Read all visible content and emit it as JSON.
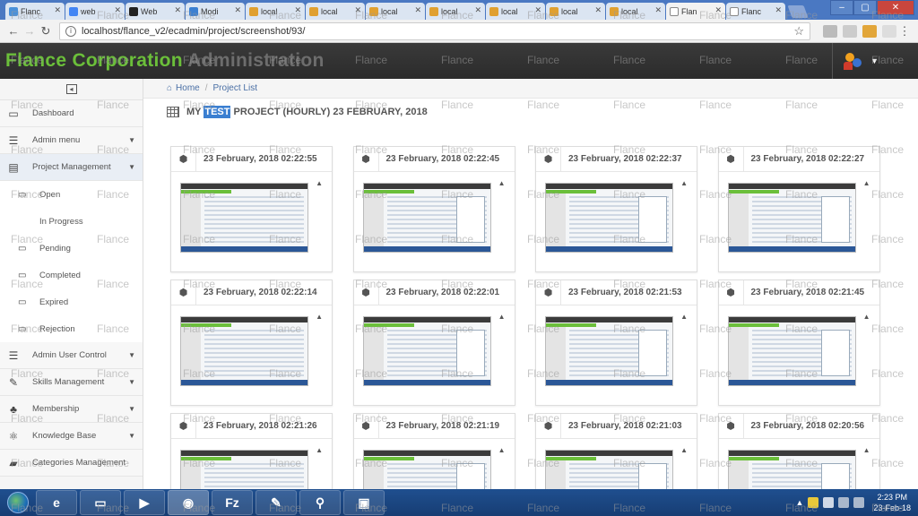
{
  "browser": {
    "tabs": [
      {
        "label": "Flanc",
        "active": false,
        "favicon_color": "#4a90d9"
      },
      {
        "label": "web",
        "active": false,
        "favicon_color": "#4285f4"
      },
      {
        "label": "Web",
        "active": false,
        "favicon_color": "#222222"
      },
      {
        "label": "Modi",
        "active": false,
        "favicon_color": "#3b7fd1"
      },
      {
        "label": "local",
        "active": false,
        "favicon_color": "#e0a030"
      },
      {
        "label": "local",
        "active": false,
        "favicon_color": "#e0a030"
      },
      {
        "label": "local",
        "active": false,
        "favicon_color": "#e0a030"
      },
      {
        "label": "local",
        "active": false,
        "favicon_color": "#e0a030"
      },
      {
        "label": "local",
        "active": false,
        "favicon_color": "#e0a030"
      },
      {
        "label": "local",
        "active": false,
        "favicon_color": "#e0a030"
      },
      {
        "label": "local",
        "active": false,
        "favicon_color": "#e0a030"
      },
      {
        "label": "Flan",
        "active": true,
        "favicon_color": "#ffffff"
      },
      {
        "label": "Flanc",
        "active": false,
        "favicon_color": "#ffffff"
      }
    ],
    "url": "localhost/flance_v2/ecadmin/project/screenshot/93/"
  },
  "app": {
    "brand": "Flance Corporation",
    "brand_suffix": "Administration"
  },
  "sidebar": {
    "items": [
      {
        "label": "Dashboard",
        "icon": "monitor-icon",
        "glyph": "▭",
        "arrow": false
      },
      {
        "label": "Admin menu",
        "icon": "list-icon",
        "glyph": "☰",
        "arrow": true
      },
      {
        "label": "Project Management",
        "icon": "project-icon",
        "glyph": "▤",
        "arrow": true,
        "active": true
      }
    ],
    "sub_items": [
      {
        "label": "Open",
        "glyph": "▭"
      },
      {
        "label": "In Progress",
        "glyph": ""
      },
      {
        "label": "Pending",
        "glyph": "▭"
      },
      {
        "label": "Completed",
        "glyph": "▭"
      },
      {
        "label": "Expired",
        "glyph": "▭"
      },
      {
        "label": "Rejection",
        "glyph": "▭"
      }
    ],
    "more_items": [
      {
        "label": "Admin User Control",
        "icon": "list-icon",
        "glyph": "☰",
        "arrow": true
      },
      {
        "label": "Skills Management",
        "icon": "wrench-icon",
        "glyph": "✎",
        "arrow": true
      },
      {
        "label": "Membership",
        "icon": "users-icon",
        "glyph": "♣",
        "arrow": true
      },
      {
        "label": "Knowledge Base",
        "icon": "atom-icon",
        "glyph": "⚛",
        "arrow": true
      },
      {
        "label": "Categories Management",
        "icon": "folder-icon",
        "glyph": "▰",
        "arrow": false
      }
    ]
  },
  "breadcrumb": {
    "home": "Home",
    "sep": "/",
    "current": "Project List"
  },
  "page": {
    "title_pre": "MY ",
    "title_highlight": "TEST",
    "title_post": " PROJECT (HOURLY) 23 FEBRUARY, 2018"
  },
  "screenshots": [
    "23 February, 2018 02:22:55",
    "23 February, 2018 02:22:45",
    "23 February, 2018 02:22:37",
    "23 February, 2018 02:22:27",
    "23 February, 2018 02:22:14",
    "23 February, 2018 02:22:01",
    "23 February, 2018 02:21:53",
    "23 February, 2018 02:21:45",
    "23 February, 2018 02:21:26",
    "23 February, 2018 02:21:19",
    "23 February, 2018 02:21:03",
    "23 February, 2018 02:20:56"
  ],
  "watermark_text": "Flance",
  "taskbar": {
    "apps": [
      "ie-icon",
      "explorer-icon",
      "media-icon",
      "chrome-icon",
      "filezilla-icon",
      "notepad-icon",
      "network-icon",
      "app-icon"
    ],
    "time": "2:23 PM",
    "date": "23-Feb-18"
  }
}
